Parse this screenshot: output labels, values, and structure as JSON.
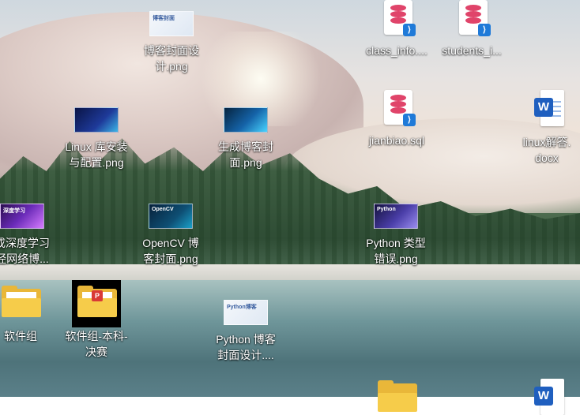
{
  "desktop": {
    "icons": [
      {
        "label": "博客封面设\n计.png",
        "icon": "image-thumbnail-icon"
      },
      {
        "label": "class_info....",
        "icon": "sql-file-icon"
      },
      {
        "label": "students_i...",
        "icon": "sql-file-icon"
      },
      {
        "label": "Linux 库安装\n与配置.png",
        "icon": "image-thumbnail-icon"
      },
      {
        "label": "生成博客封\n面.png",
        "icon": "image-thumbnail-icon"
      },
      {
        "label": "jianbiao.sql",
        "icon": "sql-file-icon"
      },
      {
        "label": "linux解答.\ndocx",
        "icon": "word-document-icon"
      },
      {
        "label": "成深度学习\n经网络博...",
        "icon": "image-thumbnail-icon"
      },
      {
        "label": "OpenCV 博\n客封面.png",
        "icon": "image-thumbnail-icon"
      },
      {
        "label": "Python 类型\n错误.png",
        "icon": "image-thumbnail-icon"
      },
      {
        "label": "软件组",
        "icon": "folder-icon"
      },
      {
        "label": "软件组-本科-\n决赛",
        "icon": "folder-icon"
      },
      {
        "label": "Python 博客\n封面设计....",
        "icon": "image-thumbnail-icon"
      }
    ],
    "thumb_captions": {
      "blog_cover": "博客封面",
      "opencv": "OpenCV",
      "cnn": "深度学习",
      "python_type": "Python",
      "python_blog": "Python博客"
    },
    "word_letter": "W",
    "vs_letter": "⟩"
  }
}
